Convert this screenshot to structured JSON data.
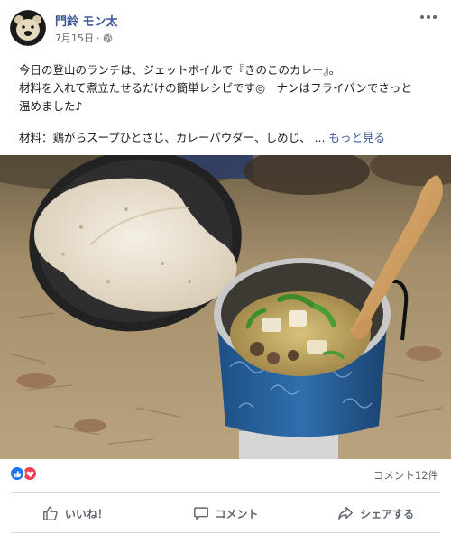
{
  "post": {
    "author": "門鈴 モン太",
    "date": "7月15日",
    "privacy_icon": "globe-icon",
    "text_lines": [
      "今日の登山のランチは、ジェットボイルで『きのこのカレー』。",
      "材料を入れて煮立たせるだけの簡単レシピです◎　ナンはフライパンでさっと",
      "温めました♪"
    ],
    "ingredients_prefix": "材料：鶏がらスープひとさじ、カレーパウダー、しめじ、",
    "ellipsis": "...",
    "see_more": "もっと見る"
  },
  "reactions": {
    "icons": [
      "like-icon",
      "love-icon"
    ],
    "comment_count": "コメント12件"
  },
  "actions": {
    "like": "いいね！",
    "comment": "コメント",
    "share": "シェアする"
  },
  "colors": {
    "author_link": "#385898",
    "like_blue": "#1877f2",
    "love_red": "#f33e58",
    "muted_text": "#616770"
  }
}
